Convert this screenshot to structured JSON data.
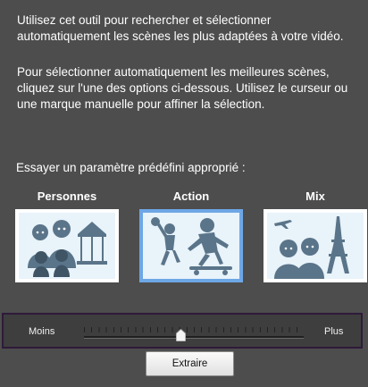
{
  "intro": {
    "paragraph1": "Utilisez cet outil pour rechercher et sélectionner automatiquement les scènes les plus adaptées à votre vidéo.",
    "paragraph2": "Pour sélectionner automatiquement les meilleures scènes, cliquez sur l'une des options ci-dessous. Utilisez le curseur ou une marque manuelle pour affiner la sélection."
  },
  "presets": {
    "prompt": "Essayer un paramètre prédéfini approprié :",
    "items": [
      {
        "label": "Personnes",
        "icon": "people-carousel-icon",
        "selected": false
      },
      {
        "label": "Action",
        "icon": "skateboard-action-icon",
        "selected": true
      },
      {
        "label": "Mix",
        "icon": "couple-eiffel-tower-icon",
        "selected": false
      }
    ]
  },
  "slider": {
    "min_label": "Moins",
    "max_label": "Plus",
    "value": 0.44
  },
  "extract_button": "Extraire",
  "colors": {
    "background": "#4d4d4d",
    "illustration": "#5a7489",
    "illustration_bg": "#e8f3fa",
    "selected_border": "#6ea7e6"
  }
}
